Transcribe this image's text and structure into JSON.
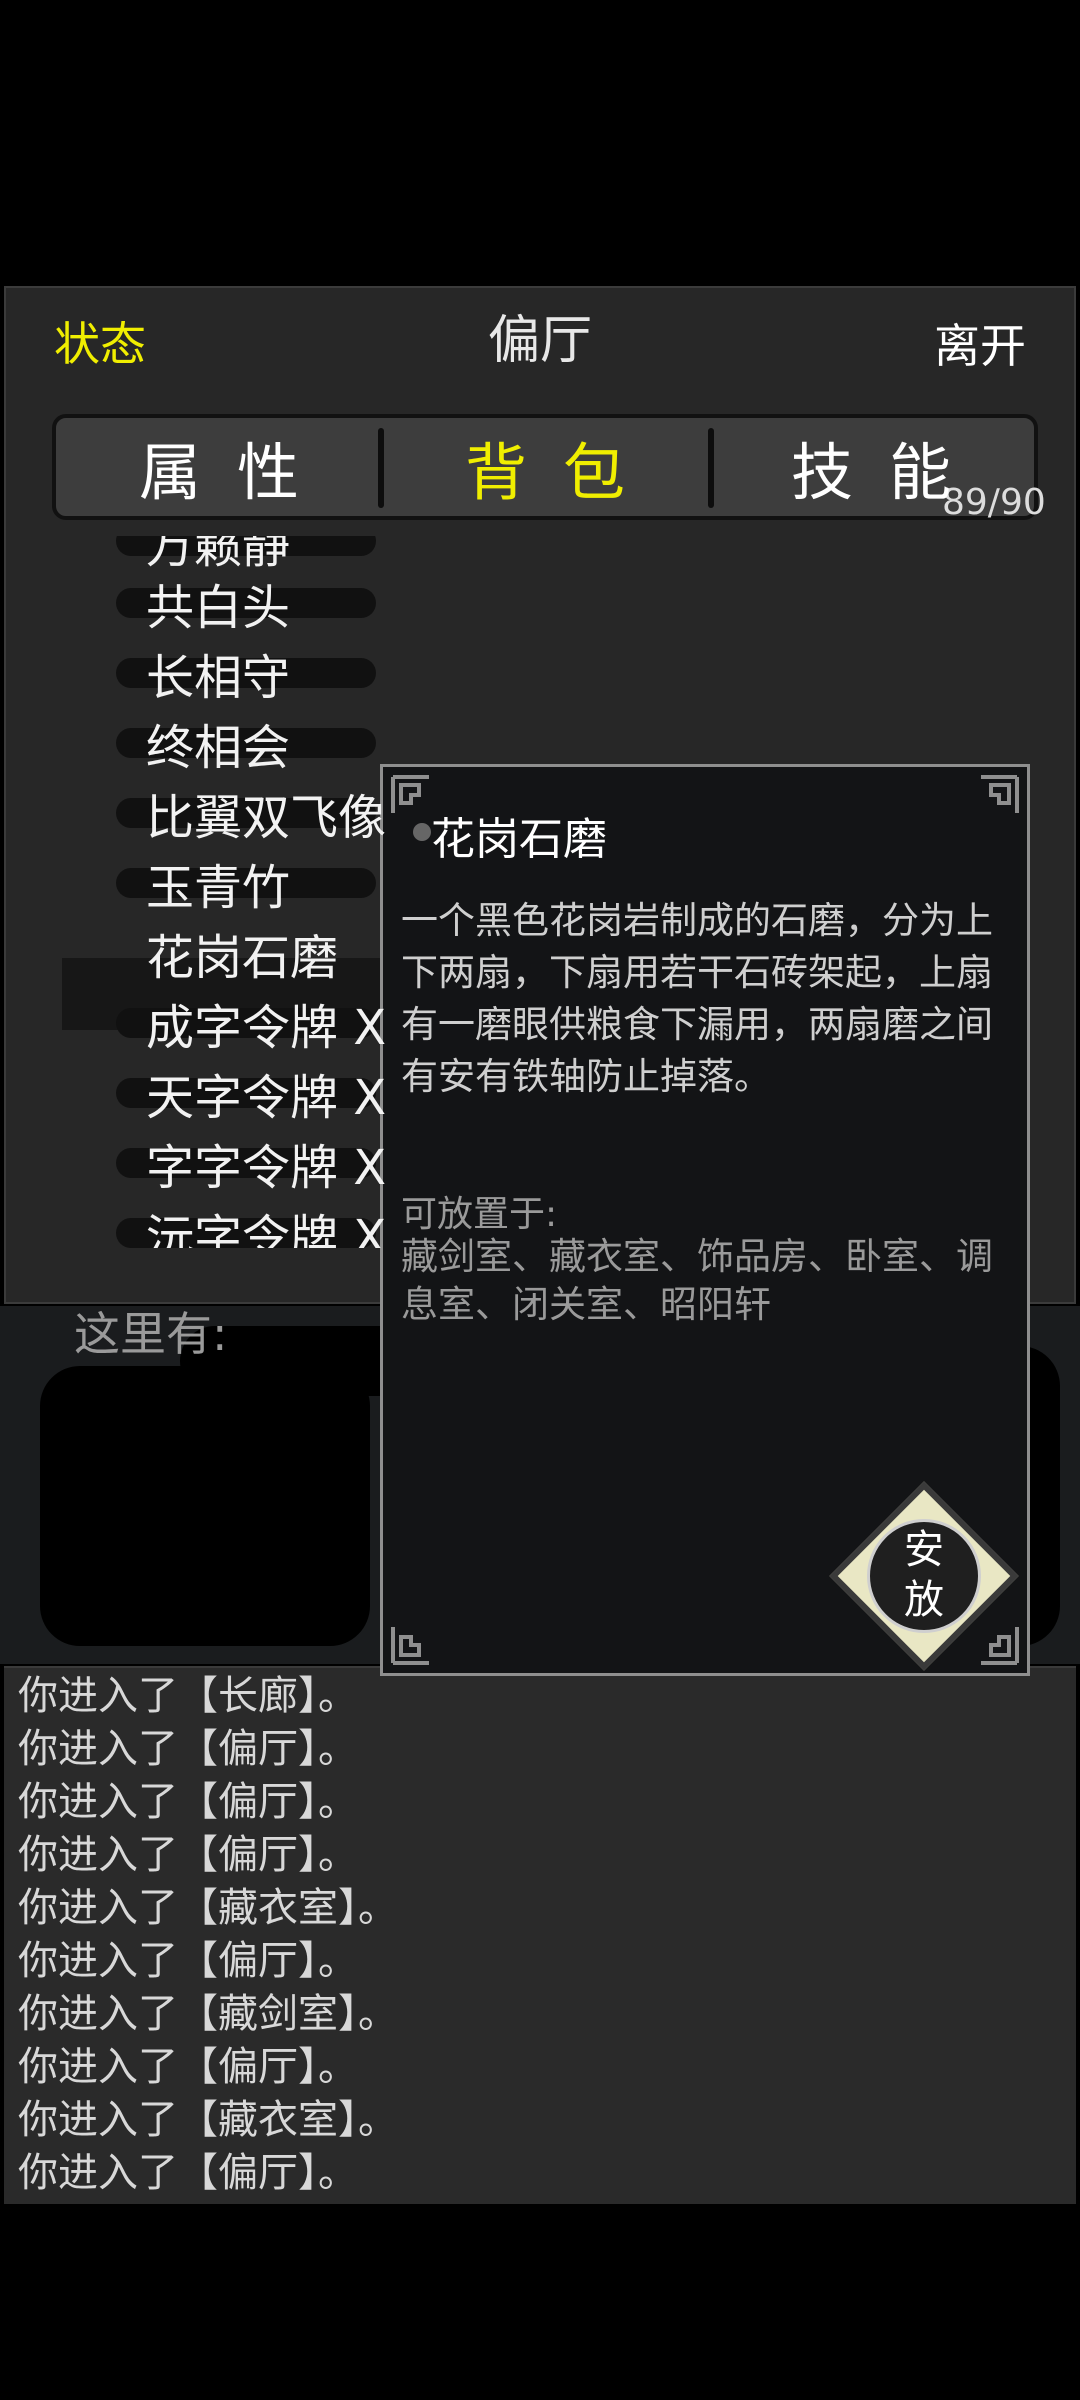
{
  "header": {
    "status": "状态",
    "title": "偏厅",
    "leave": "离开"
  },
  "tabs": [
    {
      "label": "属性"
    },
    {
      "label": "背包"
    },
    {
      "label": "技能"
    }
  ],
  "bag_count": "89/90",
  "items": [
    {
      "label": "万籁静"
    },
    {
      "label": "共白头"
    },
    {
      "label": "长相守"
    },
    {
      "label": "终相会"
    },
    {
      "label": "比翼双飞像"
    },
    {
      "label": "玉青竹"
    },
    {
      "label": "花岗石磨"
    },
    {
      "label": "成字令牌 X"
    },
    {
      "label": "天字令牌 X"
    },
    {
      "label": "字字令牌 X"
    },
    {
      "label": "沅字令牌 X"
    }
  ],
  "here_label": "这里有:",
  "popup": {
    "title": "花岗石磨",
    "desc": "一个黑色花岗岩制成的石磨，分为上下两扇，下扇用若干石砖架起，上扇有一磨眼供粮食下漏用，两扇磨之间有安有铁轴防止掉落。",
    "place_label": "可放置于:",
    "place_rooms": "藏剑室、藏衣室、饰品房、卧室、调息室、闭关室、昭阳轩",
    "button": "安放"
  },
  "log": [
    "你进入了【长廊】。",
    "你进入了【偏厅】。",
    "你进入了【偏厅】。",
    "你进入了【偏厅】。",
    "你进入了【藏衣室】。",
    "你进入了【偏厅】。",
    "你进入了【藏剑室】。",
    "你进入了【偏厅】。",
    "你进入了【藏衣室】。",
    "你进入了【偏厅】。"
  ],
  "colors": {
    "accent": "#f0ee00",
    "panel": "#272727",
    "popup_border": "#8f8f8f"
  }
}
